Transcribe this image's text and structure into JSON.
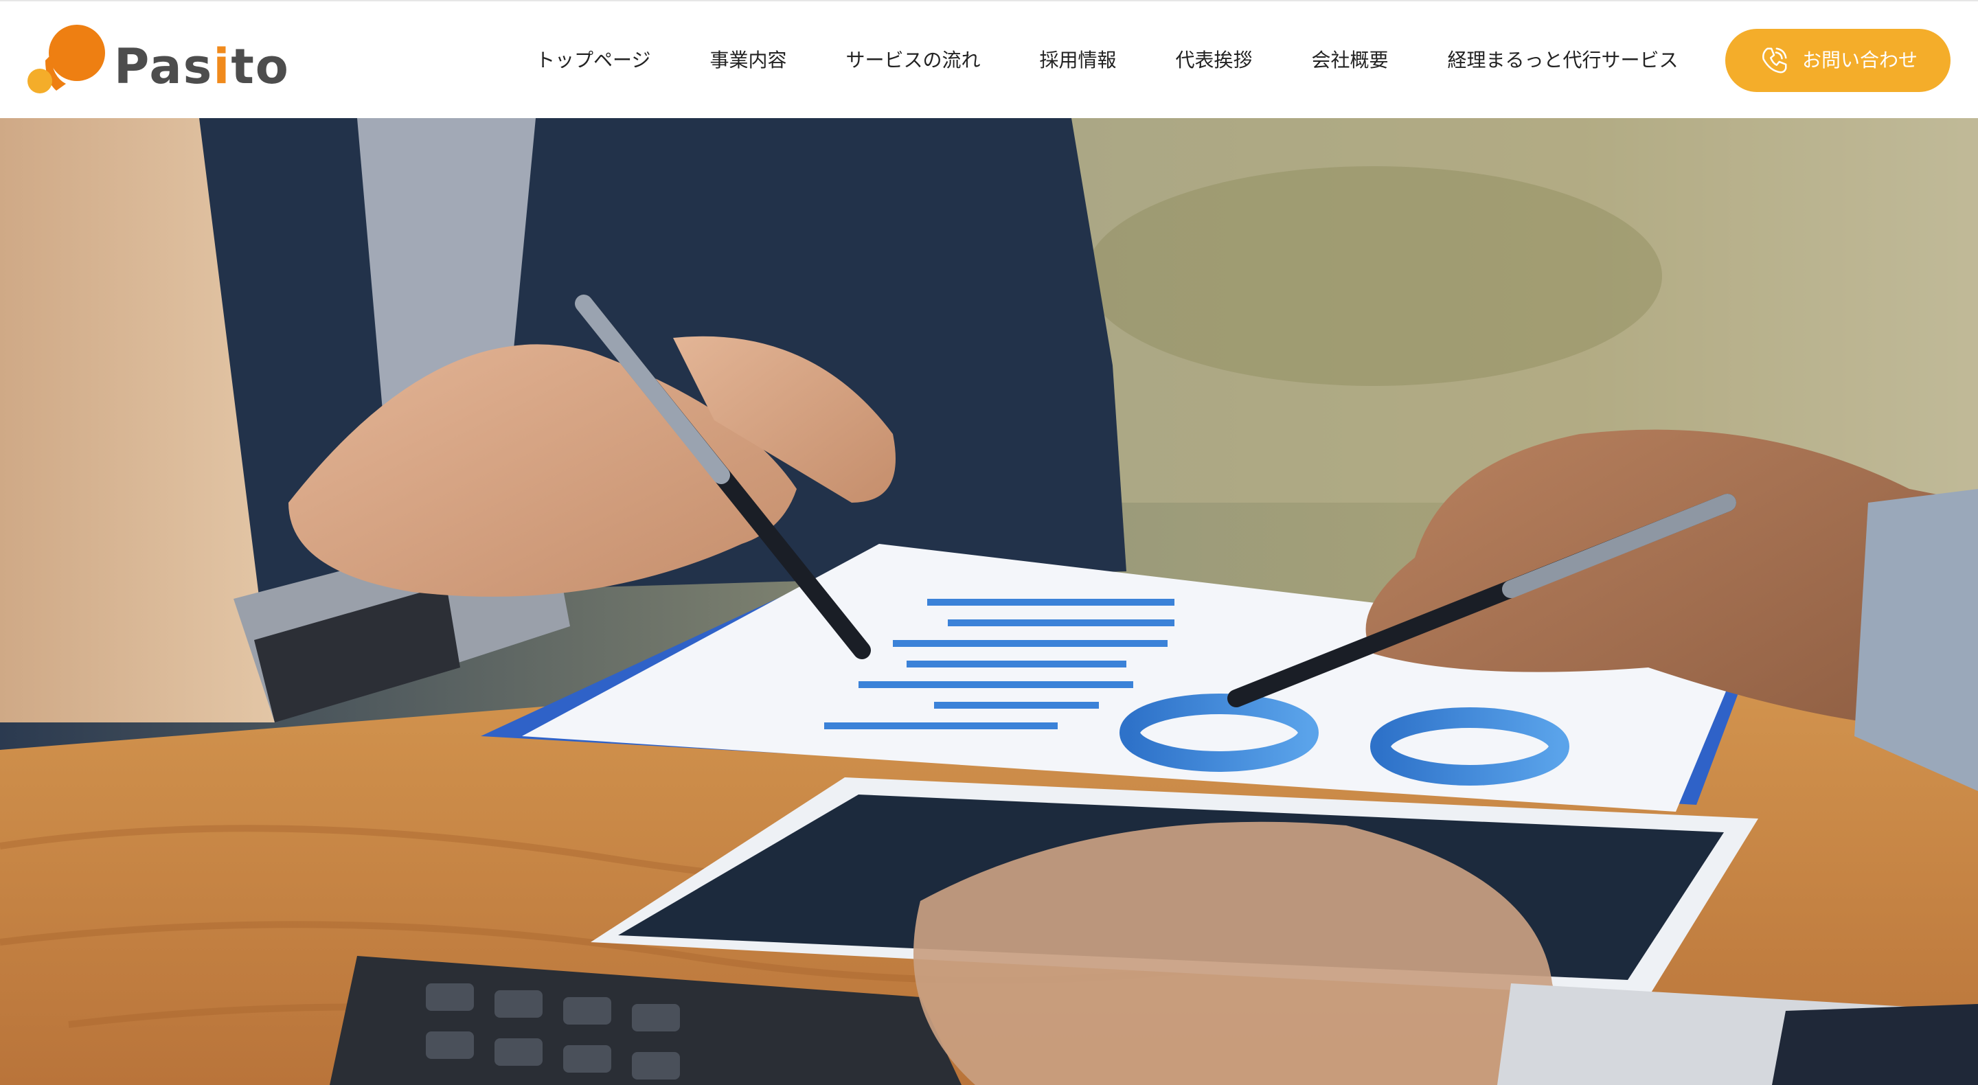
{
  "brand": {
    "name_prefix": "Pas",
    "name_i": "i",
    "name_suffix": "to",
    "colors": {
      "orange": "#ee7f12",
      "yellow": "#f4ad2a",
      "gray": "#4d4d4d"
    }
  },
  "nav": {
    "items": [
      {
        "label": "トップページ"
      },
      {
        "label": "事業内容"
      },
      {
        "label": "サービスの流れ"
      },
      {
        "label": "採用情報"
      },
      {
        "label": "代表挨拶"
      },
      {
        "label": "会社概要"
      },
      {
        "label": "経理まるっと代行サービス"
      }
    ]
  },
  "contact": {
    "label": "お問い合わせ",
    "icon": "phone-icon",
    "color": "#f4ad2a"
  },
  "hero": {
    "image": "business-meeting-charts-photo",
    "colors": {
      "desk": "#c98a45",
      "chart_blue": "#2f7bd6",
      "suit": "#223248"
    }
  }
}
